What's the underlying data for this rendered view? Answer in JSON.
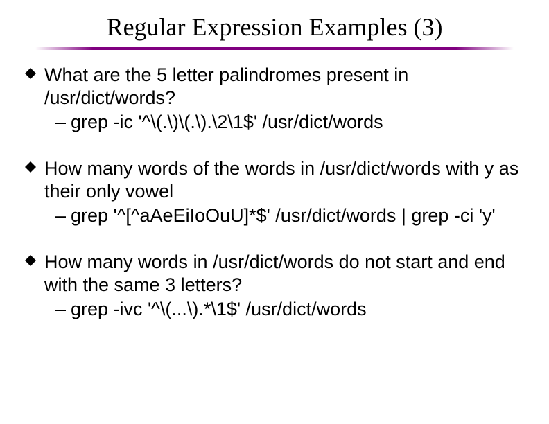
{
  "slide": {
    "title": "Regular Expression Examples (3)",
    "items": [
      {
        "question": "What are the 5 letter palindromes present in /usr/dict/words?",
        "answer": "grep -ic '^\\(.\\)\\(.\\).\\2\\1$' /usr/dict/words"
      },
      {
        "question": "How many words of the words in /usr/dict/words with y as their only vowel",
        "answer": "grep '^[^aAeEiIoOuU]*$' /usr/dict/words | grep -ci 'y'"
      },
      {
        "question": "How many words in /usr/dict/words do not start and end with the same 3 letters?",
        "answer": "grep -ivc '^\\(...\\).*\\1$' /usr/dict/words"
      }
    ],
    "dash": "–"
  }
}
